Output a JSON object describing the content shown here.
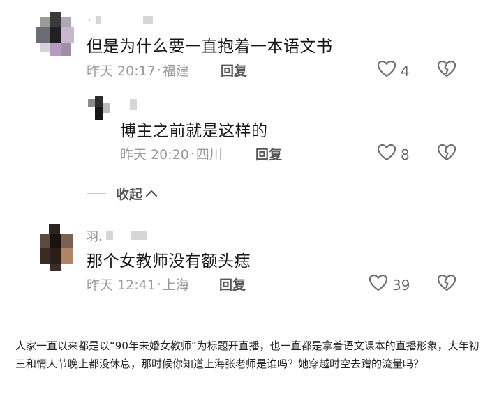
{
  "comments": [
    {
      "username": "·",
      "text": "但是为什么要一直抱着一本语文书",
      "time": "昨天 20:17",
      "location": "福建",
      "reply_label": "回复",
      "like_count": "4"
    },
    {
      "username": "",
      "text": "博主之前就是这样的",
      "time": "昨天 20:20",
      "location": "四川",
      "reply_label": "回复",
      "like_count": "8"
    },
    {
      "username": "羽.",
      "text": "那个女教师没有额头痣",
      "time": "昨天 12:41",
      "location": "上海",
      "reply_label": "回复",
      "like_count": "39"
    }
  ],
  "collapse_label": "收起",
  "separator": "·",
  "article_text": "人家一直以来都是以“90年未婚女教师”为标题开直播，也一直都是拿着语文课本的直播形象，大年初三和情人节晚上都没休息，那时候你知道上海张老师是谁吗？她穿越时空去蹭的流量吗？",
  "icons": {
    "like": "heart-outline-icon",
    "dislike": "broken-heart-icon",
    "collapse": "chevron-up-icon"
  }
}
